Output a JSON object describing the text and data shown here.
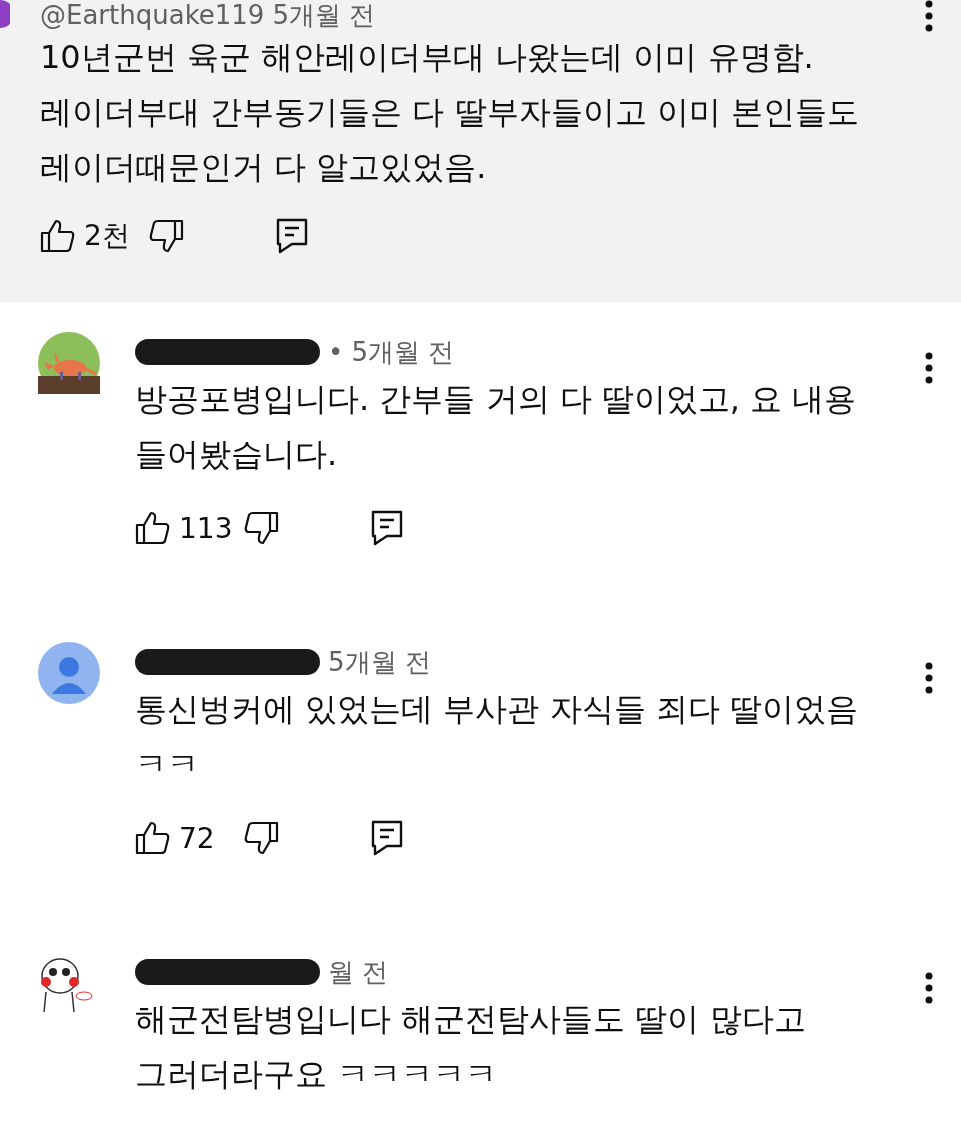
{
  "comments": [
    {
      "kind": "highlighted",
      "author": "@Earthquake119",
      "time": "5개월 전",
      "redacted": false,
      "avatar": {
        "kind": "purple"
      },
      "text": "10년군번 육군 해안레이더부대 나왔는데 이미 유명함. 레이더부대 간부동기들은 다 딸부자들이고 이미 본인들도 레이더때문인거 다 알고있었음.",
      "likes": "2천"
    },
    {
      "kind": "reply",
      "time": "• 5개월 전",
      "redacted": true,
      "avatar": {
        "kind": "aardvark"
      },
      "text": "방공포병입니다. 간부들 거의 다 딸이었고, 요 내용 들어봤습니다.",
      "likes": "113"
    },
    {
      "kind": "reply",
      "time": "5개월 전",
      "redacted": true,
      "avatar": {
        "kind": "default"
      },
      "text": "통신벙커에 있었는데 부사관 자식들 죄다 딸이었음 ㅋㅋ",
      "likes": "72"
    },
    {
      "kind": "reply",
      "time": "월 전",
      "redacted": true,
      "avatar": {
        "kind": "sticker"
      },
      "text": "해군전탐병입니다 해군전탐사들도 딸이 많다고 그러더라구요 ㅋㅋㅋㅋㅋ"
    }
  ]
}
